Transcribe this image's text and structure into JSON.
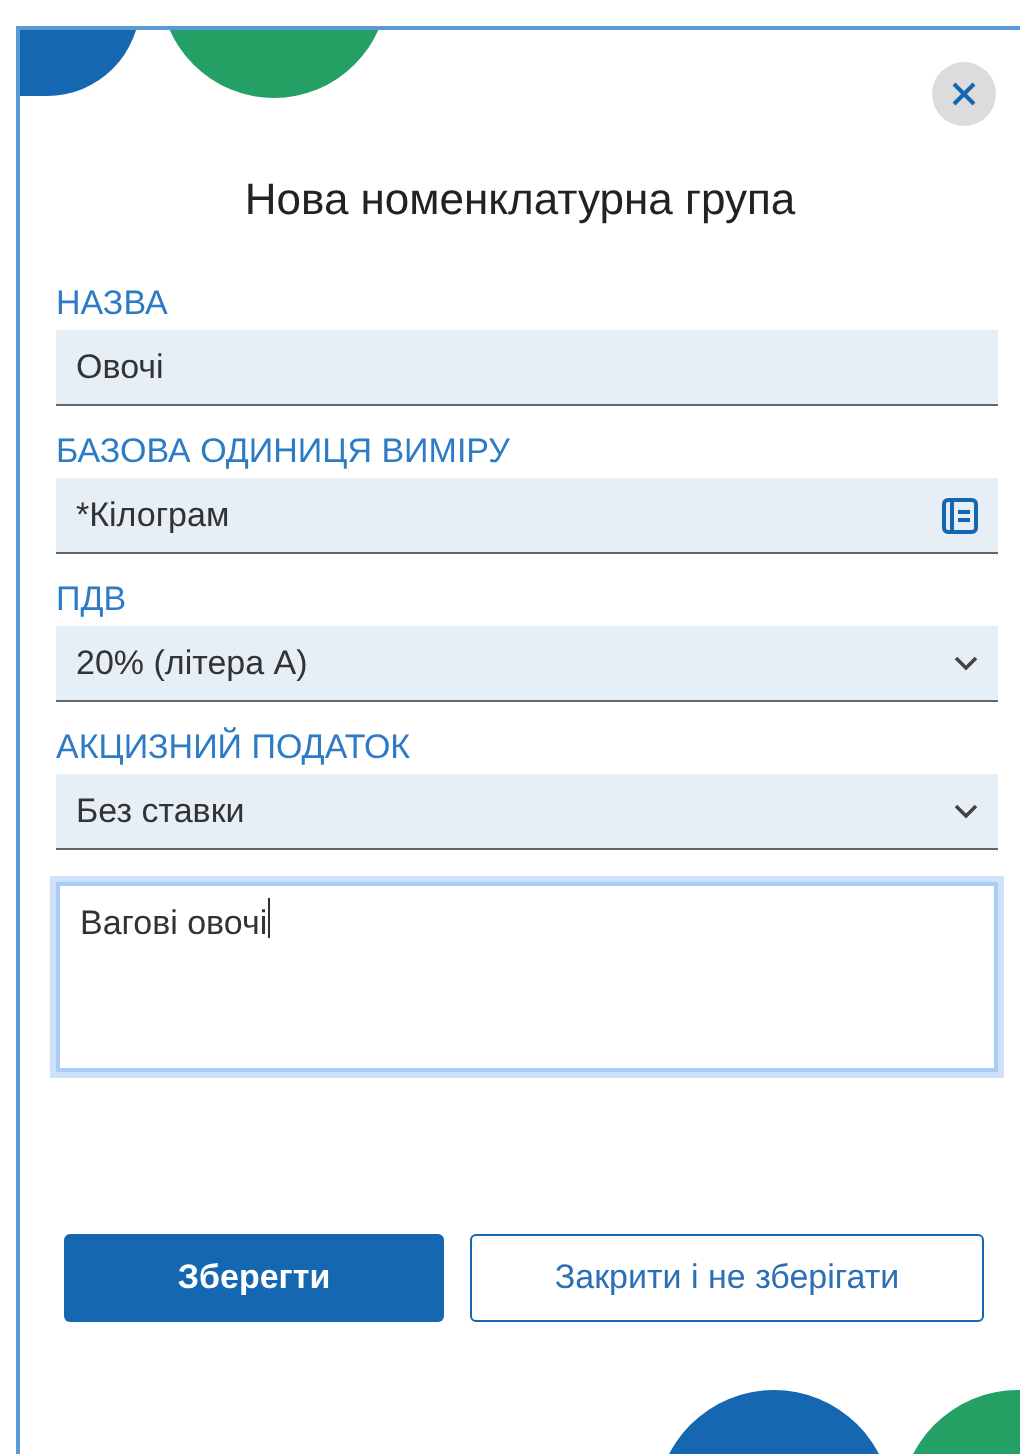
{
  "dialog": {
    "title": "Нова номенклатурна група",
    "fields": [
      {
        "kind": "text",
        "label": "НАЗВА",
        "value": "Овочі"
      },
      {
        "kind": "picker",
        "label": "БАЗОВА ОДИНИЦЯ ВИМІРУ",
        "value": "*Кілограм"
      },
      {
        "kind": "select",
        "label": "ПДВ",
        "value": "20% (літера А)"
      },
      {
        "kind": "select",
        "label": "АКЦИЗНИЙ ПОДАТОК",
        "value": "Без ставки"
      },
      {
        "kind": "textarea",
        "value": "Вагові овочі",
        "focused": true
      }
    ],
    "buttons": [
      {
        "kind": "primary",
        "label": "Зберегти"
      },
      {
        "kind": "secondary",
        "label": "Закрити і не зберігати"
      }
    ]
  }
}
